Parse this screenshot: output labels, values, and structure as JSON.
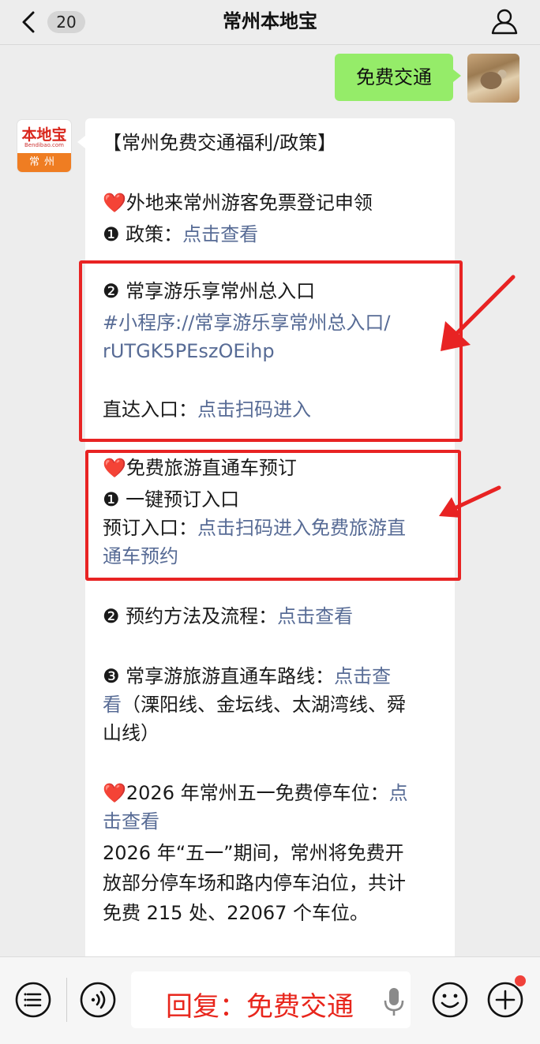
{
  "header": {
    "back_badge": "20",
    "title": "常州本地宝"
  },
  "outgoing": {
    "text": "免费交通"
  },
  "bot_avatar": {
    "logo_top": "本地宝",
    "logo_sub": "Bendibao.com",
    "logo_city": "常州"
  },
  "message": {
    "l1": "【常州免费交通福利/政策】",
    "l2_heart": "❤️",
    "l2": "外地来常州游客免票登记申领",
    "l3_label": "❶ 政策：",
    "l3_link": "点击查看",
    "l4": "❷ 常享游乐享常州总入口",
    "l5_link": "#小程序://常享游乐享常州总入口/",
    "l6_link": "rUTGK5PEszOEihp",
    "l7_label": "直达入口：",
    "l7_link": "点击扫码进入",
    "l8_heart": "❤️",
    "l8": "免费旅游直通车预订",
    "l9": "❶ 一键预订入口",
    "l10_label": "预订入口：",
    "l10_link": "点击扫码进入免费旅游直",
    "l11_link": "通车预约",
    "l12_label": "❷ 预约方法及流程：",
    "l12_link": "点击查看",
    "l13_label": "❸ 常享游旅游直通车路线：",
    "l13_link": "点击查",
    "l14_link": "看",
    "l14": "（溧阳线、金坛线、太湖湾线、舜",
    "l15": "山线）",
    "l16_heart": "❤️",
    "l16_label": "2026 年常州五一免费停车位：",
    "l16_link": "点",
    "l17_link": "击查看",
    "l18": "2026 年“五一”期间，常州将免费开",
    "l19": "放部分停车场和路内停车泊位，共计",
    "l20": "免费 215 处、22067 个车位。"
  },
  "bottom": {
    "reply_overlay": "回复：免费交通"
  },
  "colors": {
    "link": "#576b95",
    "highlight": "#e82323",
    "outgoing_bubble": "#95ec69"
  },
  "icons": [
    "back-chevron-icon",
    "profile-icon",
    "menu-list-icon",
    "voice-wave-icon",
    "microphone-icon",
    "emoji-icon",
    "add-plus-icon",
    "arrow-icon"
  ]
}
